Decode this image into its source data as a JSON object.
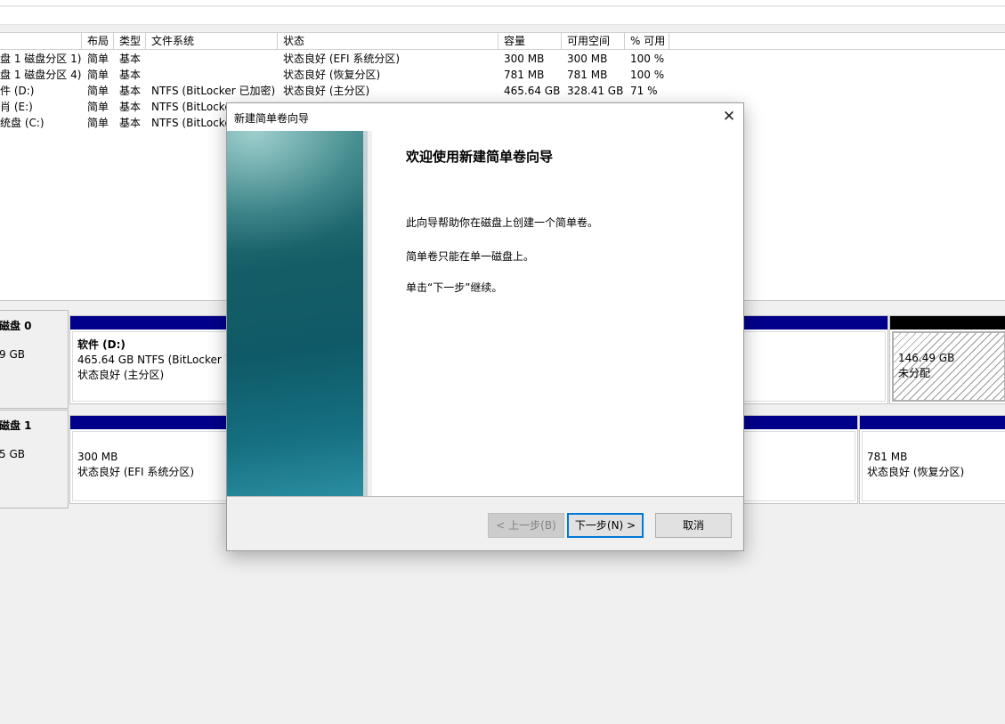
{
  "columns": [
    "布局",
    "类型",
    "文件系统",
    "状态",
    "容量",
    "可用空间",
    "% 可用"
  ],
  "volumes": [
    {
      "name": "盘 1 磁盘分区 1)",
      "layout": "简单",
      "type": "基本",
      "fs": "",
      "status": "状态良好 (EFI 系统分区)",
      "capacity": "300 MB",
      "free": "300 MB",
      "pct": "100 %"
    },
    {
      "name": "盘 1 磁盘分区 4)",
      "layout": "简单",
      "type": "基本",
      "fs": "",
      "status": "状态良好 (恢复分区)",
      "capacity": "781 MB",
      "free": "781 MB",
      "pct": "100 %"
    },
    {
      "name": "件 (D:)",
      "layout": "简单",
      "type": "基本",
      "fs": "NTFS (BitLocker 已加密)",
      "status": "状态良好 (主分区)",
      "capacity": "465.64 GB",
      "free": "328.41 GB",
      "pct": "71 %"
    },
    {
      "name": "肖 (E:)",
      "layout": "简单",
      "type": "基本",
      "fs": "NTFS (BitLocke",
      "status": "",
      "capacity": "",
      "free": "",
      "pct": ""
    },
    {
      "name": "统盘 (C:)",
      "layout": "简单",
      "type": "基本",
      "fs": "NTFS (BitLocke",
      "status": "",
      "capacity": "",
      "free": "",
      "pct": ""
    }
  ],
  "disks": [
    {
      "name": "磁盘 0",
      "size": "9 GB",
      "partitions": [
        {
          "title": "软件  (D:)",
          "line1": "465.64 GB NTFS (BitLocker 已",
          "line2": "状态良好 (主分区)"
        },
        {
          "title": "",
          "line1": "146.49 GB",
          "line2": "未分配"
        }
      ]
    },
    {
      "name": "磁盘 1",
      "size": "5 GB",
      "partitions": [
        {
          "title": "",
          "line1": "300 MB",
          "line2": "状态良好 (EFI 系统分区)"
        },
        {
          "title": "",
          "line1": "781 MB",
          "line2": "状态良好 (恢复分区)"
        }
      ]
    }
  ],
  "dialog": {
    "title": "新建简单卷向导",
    "close": "✕",
    "heading": "欢迎使用新建简单卷向导",
    "para1": "此向导帮助你在磁盘上创建一个简单卷。",
    "para2": "简单卷只能在单一磁盘上。",
    "para3": "单击“下一步”继续。",
    "back_label": "< 上一步(B)",
    "next_label": "下一步(N) >",
    "cancel_label": "取消"
  },
  "colors": {
    "primary_partition_bar": "#00008b",
    "unallocated_bar": "#000000",
    "default_button_border": "#0078d7"
  }
}
